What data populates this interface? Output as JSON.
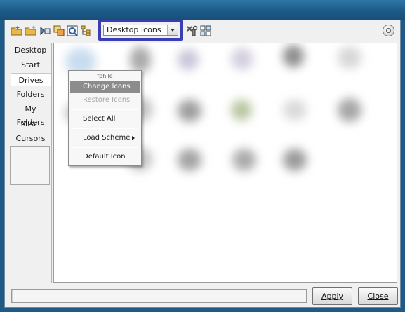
{
  "toolbar": {
    "view_selector": {
      "selected": "Desktop Icons"
    },
    "icons": [
      "open-folder-icon",
      "new-folder-icon",
      "refresh-icon",
      "copy-icon",
      "preview-icon",
      "tree-icon",
      "tools-icon",
      "grid-icon",
      "help-icon"
    ]
  },
  "sidebar": {
    "items": [
      {
        "label": "Desktop"
      },
      {
        "label": "Start"
      },
      {
        "label": "Drives"
      },
      {
        "label": "Folders"
      },
      {
        "label": "My Folders"
      },
      {
        "label": "Misc."
      },
      {
        "label": "Cursors"
      }
    ],
    "active_item": "Drives"
  },
  "context_menu": {
    "title": "fphile",
    "items": [
      {
        "label": "Change Icons",
        "state": "selected"
      },
      {
        "label": "Restore Icons",
        "state": "disabled"
      },
      {
        "label": "Select All"
      },
      {
        "label": "Load Scheme",
        "submenu": true
      },
      {
        "label": "Default Icon"
      }
    ]
  },
  "footer": {
    "apply_label": "Apply",
    "close_label": "Close"
  },
  "colors": {
    "highlight_border": "#3b3db5",
    "menu_selected": "#8c8c8c",
    "titlebar": "#1c5a88"
  }
}
